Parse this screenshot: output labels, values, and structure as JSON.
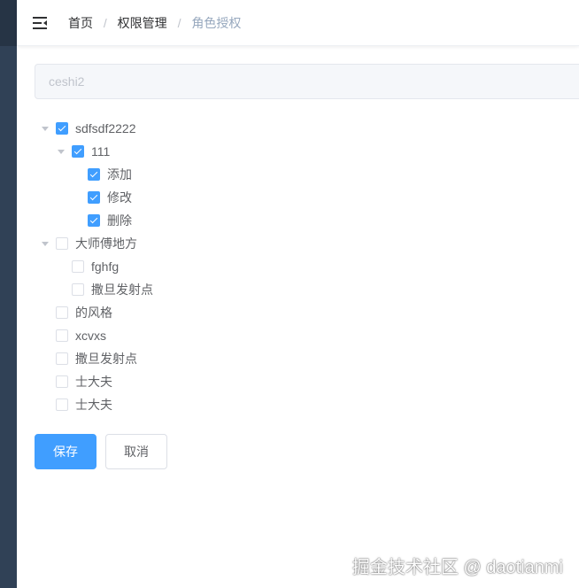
{
  "breadcrumb": {
    "home": "首页",
    "section": "权限管理",
    "current": "角色授权",
    "separator": "/"
  },
  "role_input": {
    "value": "ceshi2"
  },
  "tree": [
    {
      "label": "sdfsdf2222",
      "level": 0,
      "checked": true,
      "expandable": true
    },
    {
      "label": "111",
      "level": 1,
      "checked": true,
      "expandable": true
    },
    {
      "label": "添加",
      "level": 2,
      "checked": true,
      "expandable": false
    },
    {
      "label": "修改",
      "level": 2,
      "checked": true,
      "expandable": false
    },
    {
      "label": "删除",
      "level": 2,
      "checked": true,
      "expandable": false
    },
    {
      "label": "大师傅地方",
      "level": 0,
      "checked": false,
      "expandable": true
    },
    {
      "label": "fghfg",
      "level": 1,
      "checked": false,
      "expandable": false
    },
    {
      "label": "撒旦发射点",
      "level": 1,
      "checked": false,
      "expandable": false
    },
    {
      "label": "的风格",
      "level": 0,
      "checked": false,
      "expandable": false
    },
    {
      "label": "xcvxs",
      "level": 0,
      "checked": false,
      "expandable": false
    },
    {
      "label": "撒旦发射点",
      "level": 0,
      "checked": false,
      "expandable": false
    },
    {
      "label": "士大夫",
      "level": 0,
      "checked": false,
      "expandable": false
    },
    {
      "label": "士大夫",
      "level": 0,
      "checked": false,
      "expandable": false
    }
  ],
  "buttons": {
    "save": "保存",
    "cancel": "取消"
  },
  "watermark": "掘金技术社区 @ daotianmi",
  "colors": {
    "primary": "#409eff",
    "sidebar": "#304156",
    "text": "#606266"
  }
}
